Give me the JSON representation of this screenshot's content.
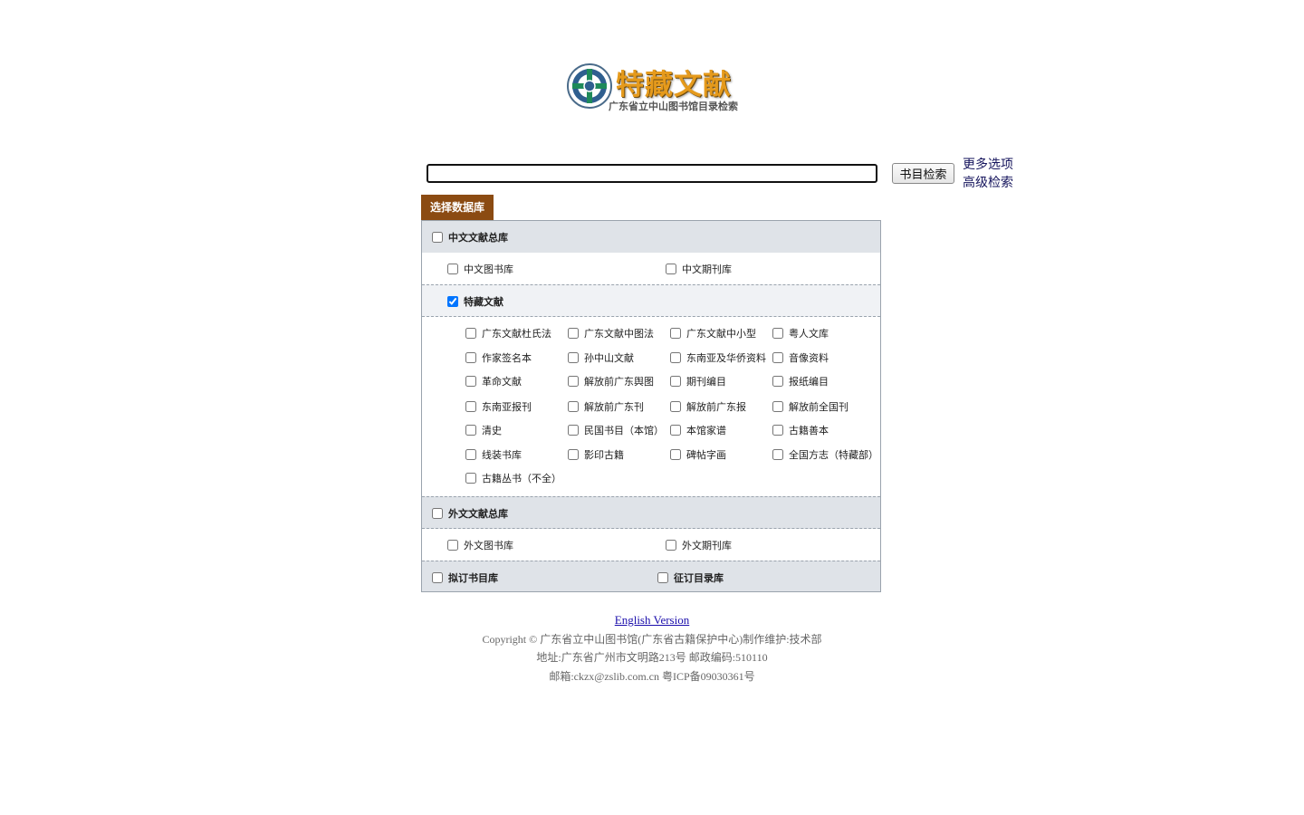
{
  "logo": {
    "title": "特藏文献",
    "subtitle": "广东省立中山图书馆目录检索"
  },
  "search": {
    "value": "",
    "button_label": "书目检索"
  },
  "links": {
    "more_options": "更多选项",
    "advanced_search": "高级检索"
  },
  "db_tab_label": "选择数据库",
  "databases": {
    "chinese_total": "中文文献总库",
    "chinese_books": "中文图书库",
    "chinese_journals": "中文期刊库",
    "special": "特藏文献",
    "special_items": [
      "广东文献杜氏法",
      "广东文献中图法",
      "广东文献中小型",
      "粤人文库",
      "作家签名本",
      "孙中山文献",
      "东南亚及华侨资料",
      "音像资料",
      "革命文献",
      "解放前广东舆图",
      "期刊编目",
      "报纸编目",
      "东南亚报刊",
      "解放前广东刊",
      "解放前广东报",
      "解放前全国刊",
      "清史",
      "民国书目（本馆）",
      "本馆家谱",
      "古籍善本",
      "线装书库",
      "影印古籍",
      "碑帖字画",
      "全国方志（特藏部）",
      "古籍丛书（不全）"
    ],
    "foreign_total": "外文文献总库",
    "foreign_books": "外文图书库",
    "foreign_journals": "外文期刊库",
    "proposed_catalog": "拟订书目库",
    "solicit_catalog": "征订目录库"
  },
  "footer": {
    "english_link": "English Version",
    "copyright": "Copyright © 广东省立中山图书馆(广东省古籍保护中心)制作维护:技术部",
    "address": "地址:广东省广州市文明路213号 邮政编码:510110",
    "email": "邮箱:ckzx@zslib.com.cn 粤ICP备09030361号"
  }
}
